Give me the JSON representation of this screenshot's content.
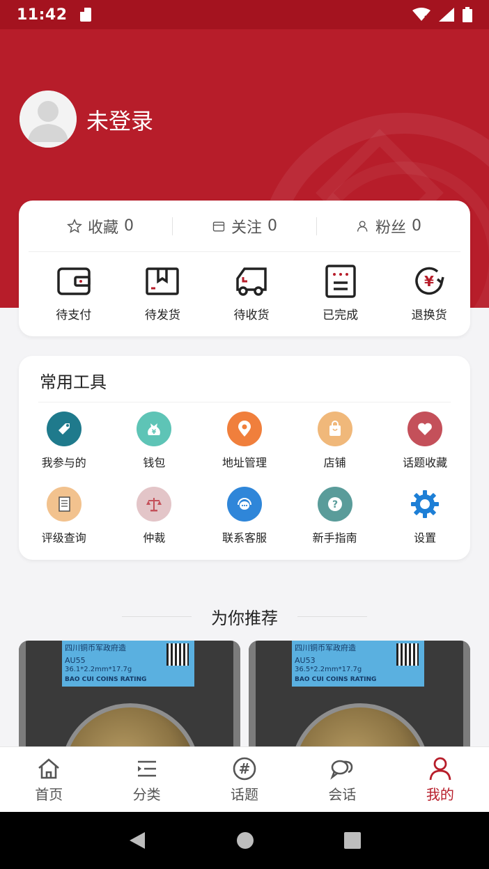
{
  "status_bar": {
    "time": "11:42"
  },
  "profile": {
    "username": "未登录"
  },
  "stats": [
    {
      "label": "收藏",
      "count": "0",
      "icon": "star-icon"
    },
    {
      "label": "关注",
      "count": "0",
      "icon": "store-icon"
    },
    {
      "label": "粉丝",
      "count": "0",
      "icon": "user-icon"
    }
  ],
  "orders": [
    {
      "label": "待支付",
      "icon": "wallet-icon"
    },
    {
      "label": "待发货",
      "icon": "package-icon"
    },
    {
      "label": "待收货",
      "icon": "truck-icon"
    },
    {
      "label": "已完成",
      "icon": "list-done-icon"
    },
    {
      "label": "退换货",
      "icon": "yuan-return-icon"
    }
  ],
  "tools": {
    "title": "常用工具",
    "items": [
      {
        "label": "我参与的",
        "icon": "tag-icon",
        "color": "#1f7a8c"
      },
      {
        "label": "钱包",
        "icon": "money-bag-icon",
        "color": "#5ec4b6"
      },
      {
        "label": "地址管理",
        "icon": "location-pin-icon",
        "color": "#f07f3c"
      },
      {
        "label": "店铺",
        "icon": "shopping-bag-icon",
        "color": "#f0b87a"
      },
      {
        "label": "话题收藏",
        "icon": "heart-icon",
        "color": "#c4505a"
      },
      {
        "label": "评级查询",
        "icon": "document-icon",
        "color": "#f2c28e"
      },
      {
        "label": "仲裁",
        "icon": "scales-icon",
        "color": "#e3c5c8"
      },
      {
        "label": "联系客服",
        "icon": "headset-chat-icon",
        "color": "#2f86d9"
      },
      {
        "label": "新手指南",
        "icon": "question-icon",
        "color": "#5a9c9a"
      },
      {
        "label": "设置",
        "icon": "gear-icon",
        "color": "#1d7fd6"
      }
    ]
  },
  "recommend": {
    "title": "为你推荐",
    "products": [
      {
        "slab_title": "四川铜币军政府造",
        "grade": "AU55",
        "spec": "36.1*2.2mm*17.7g",
        "rating": "BAO CUI COINS RATING"
      },
      {
        "slab_title": "四川铜币军政府造",
        "grade": "AU53",
        "spec": "36.5*2.2mm*17.7g",
        "rating": "BAO CUI COINS RATING"
      }
    ]
  },
  "tabbar": [
    {
      "label": "首页",
      "icon": "home-icon",
      "active": false
    },
    {
      "label": "分类",
      "icon": "category-list-icon",
      "active": false
    },
    {
      "label": "话题",
      "icon": "hashtag-icon",
      "active": false
    },
    {
      "label": "会话",
      "icon": "chat-bubbles-icon",
      "active": false
    },
    {
      "label": "我的",
      "icon": "person-icon",
      "active": true
    }
  ],
  "colors": {
    "brand_red": "#b71d2a",
    "status_bar_red": "#a4131f"
  }
}
